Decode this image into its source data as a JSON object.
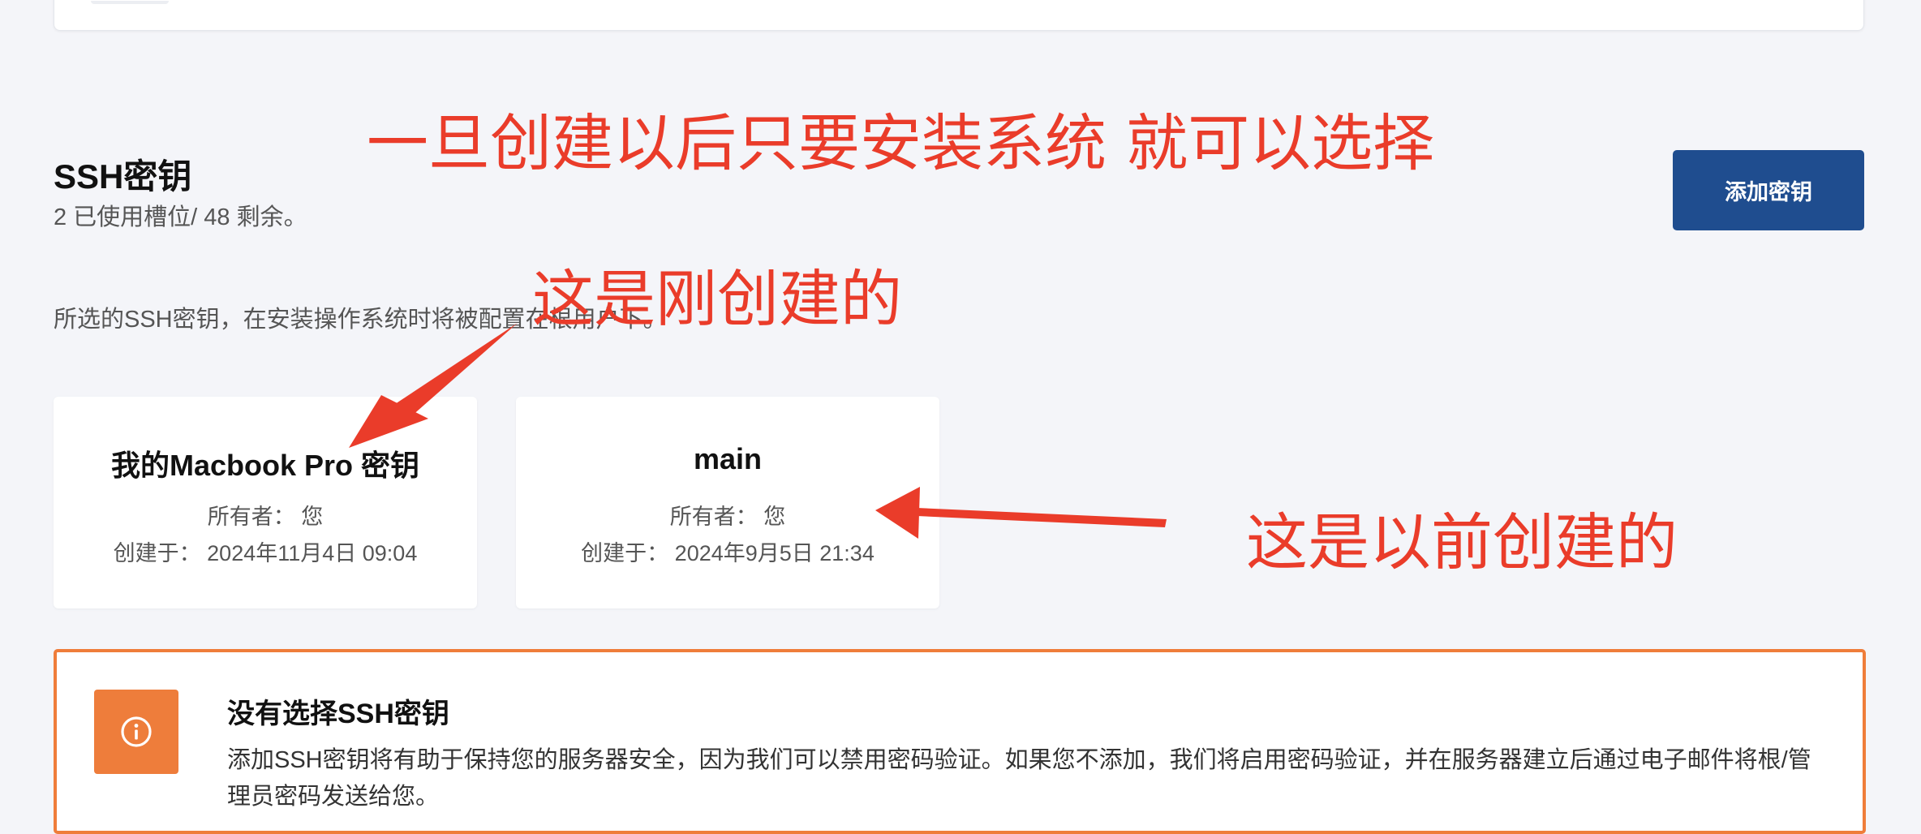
{
  "header": {
    "title": "SSH密钥",
    "usage": "2 已使用槽位/ 48 剩余。",
    "add_button_label": "添加密钥"
  },
  "description": "所选的SSH密钥，在安装操作系统时将被配置在根用户下。",
  "keys": [
    {
      "name": "我的Macbook Pro 密钥",
      "owner_label": "所有者：",
      "owner": "您",
      "created_label": "创建于：",
      "created": "2024年11月4日 09:04"
    },
    {
      "name": "main",
      "owner_label": "所有者：",
      "owner": "您",
      "created_label": "创建于：",
      "created": "2024年9月5日 21:34"
    }
  ],
  "warning": {
    "title": "没有选择SSH密钥",
    "text": "添加SSH密钥将有助于保持您的服务器安全，因为我们可以禁用密码验证。如果您不添加，我们将启用密码验证，并在服务器建立后通过电子邮件将根/管理员密码发送给您。",
    "icon": "info-icon",
    "color": "#ee7d3b"
  },
  "annotations": {
    "install_note": "一旦创建以后只要安装系统 就可以选择",
    "new_note": "这是刚创建的",
    "old_note": "这是以前创建的",
    "color": "#ea3c2a"
  },
  "colors": {
    "accent": "#1f4d8f",
    "background": "#f4f5f9"
  }
}
